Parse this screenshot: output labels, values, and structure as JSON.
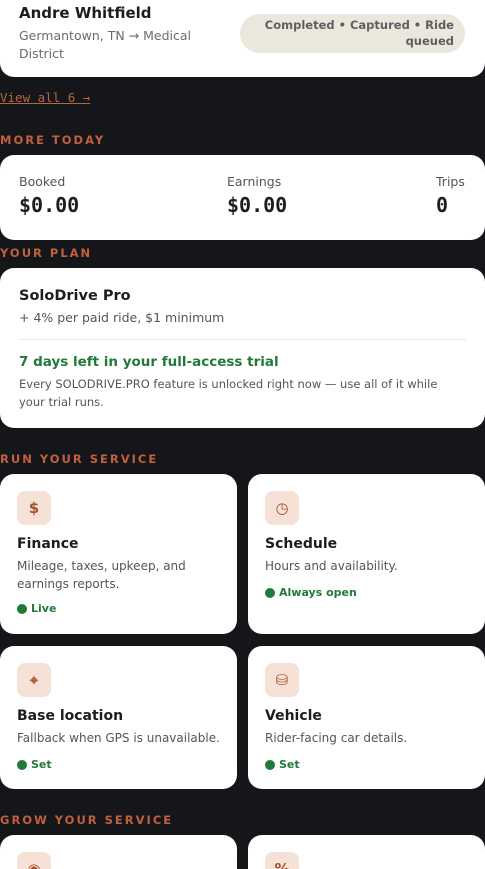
{
  "recent_ride": {
    "name": "Andre Whitfield",
    "location": "Germantown, TN → Medical District",
    "status": "Completed • Captured • Ride queued"
  },
  "view_all_label": "View all 6 →",
  "more_today": {
    "section_label": "MORE TODAY",
    "stats": [
      {
        "label": "Booked",
        "value": "$0.00"
      },
      {
        "label": "Earnings",
        "value": "$0.00"
      },
      {
        "label": "Trips",
        "value": "0"
      }
    ]
  },
  "plan": {
    "section_label": "YOUR PLAN",
    "name": "SoloDrive Pro",
    "price": "+ 4% per paid ride, $1 minimum",
    "trial_title": "7 days left in your full-access trial",
    "trial_desc": "Every SOLODRIVE.PRO feature is unlocked right now — use all of it while your trial runs."
  },
  "run_service": {
    "section_label": "RUN YOUR SERVICE",
    "tiles": [
      {
        "title": "Finance",
        "desc": "Mileage, taxes, upkeep, and earnings reports.",
        "status": "Live",
        "icon": "dollar-icon",
        "glyph": "$"
      },
      {
        "title": "Schedule",
        "desc": "Hours and availability.",
        "status": "Always open",
        "icon": "clock-icon",
        "glyph": "◷"
      },
      {
        "title": "Base location",
        "desc": "Fallback when GPS is unavailable.",
        "status": "Set",
        "icon": "crosshair-icon",
        "glyph": "⌖"
      },
      {
        "title": "Vehicle",
        "desc": "Rider-facing car details.",
        "status": "Set",
        "icon": "car-icon",
        "glyph": "⛁"
      }
    ]
  },
  "grow_service": {
    "section_label": "GROW YOUR SERVICE",
    "tiles": [
      {
        "icon": "target-icon",
        "glyph": "◉"
      },
      {
        "icon": "percent-icon",
        "glyph": "%"
      }
    ]
  },
  "colors": {
    "background": "#15161a",
    "accent": "#c0603c",
    "success": "#227a3a",
    "icon_bg": "#f6e1d6"
  }
}
